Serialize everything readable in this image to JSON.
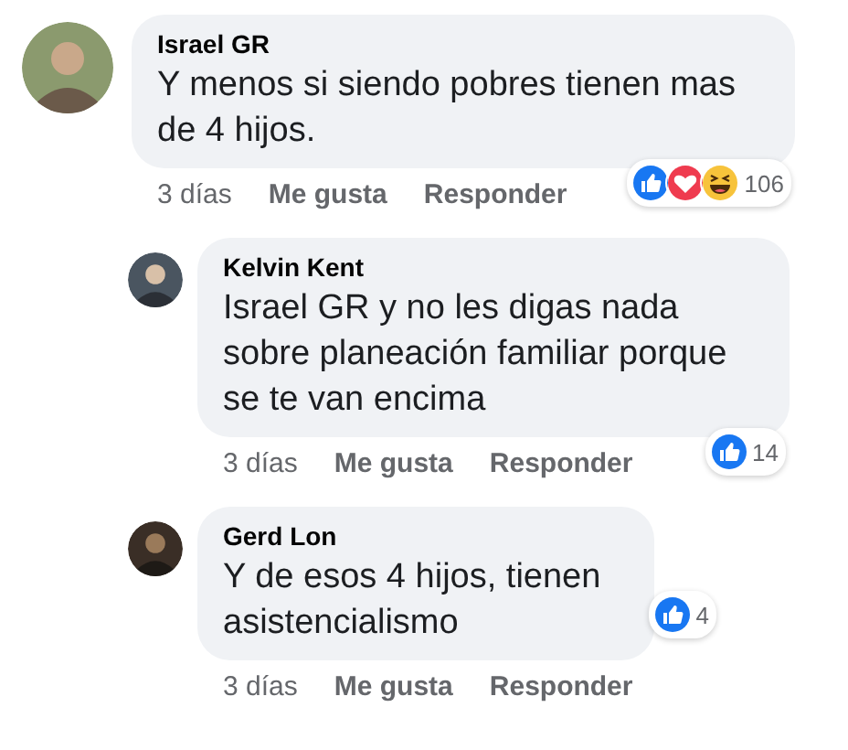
{
  "comments": [
    {
      "author": "Israel GR",
      "text": "Y menos si siendo pobres tienen mas de 4 hijos.",
      "time": "3 días",
      "like_label": "Me gusta",
      "reply_label": "Responder",
      "reactions": {
        "types": [
          {
            "kind": "like"
          },
          {
            "kind": "love"
          },
          {
            "kind": "haha"
          }
        ],
        "count": "106"
      },
      "children": [
        {
          "author": "Kelvin Kent",
          "text": "Israel GR y no les digas nada sobre planeación familiar porque se te van encima",
          "time": "3 días",
          "like_label": "Me gusta",
          "reply_label": "Responder",
          "reactions": {
            "types": [
              {
                "kind": "like"
              }
            ],
            "count": "14"
          }
        },
        {
          "author": "Gerd Lon",
          "text": "Y de esos 4 hijos, tienen asistencialismo",
          "time": "3 días",
          "like_label": "Me gusta",
          "reply_label": "Responder",
          "reactions": {
            "types": [
              {
                "kind": "like"
              }
            ],
            "count": "4"
          }
        }
      ]
    }
  ]
}
